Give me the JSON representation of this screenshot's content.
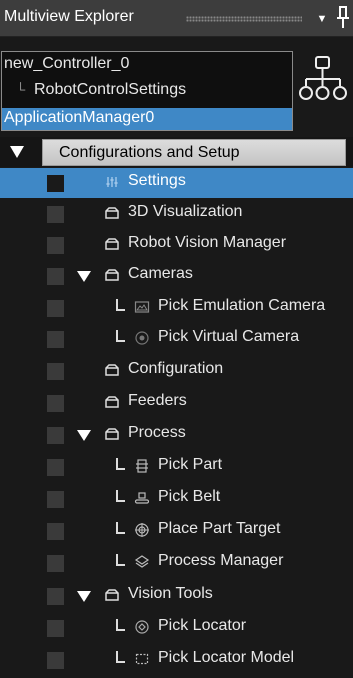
{
  "window": {
    "title": "Multiview Explorer"
  },
  "controller_box": {
    "controller": "new_Controller_0",
    "robot_settings": "RobotControlSettings",
    "app_manager": "ApplicationManager0"
  },
  "section": {
    "label": "Configurations and Setup"
  },
  "tree": [
    {
      "label": "Settings",
      "icon": "settings-icon"
    },
    {
      "label": "3D Visualization",
      "icon": "folder-icon"
    },
    {
      "label": "Robot Vision Manager",
      "icon": "folder-icon"
    },
    {
      "label": "Cameras",
      "icon": "folder-icon"
    },
    {
      "label": "Pick Emulation Camera",
      "icon": "emulation-camera-icon"
    },
    {
      "label": "Pick Virtual Camera",
      "icon": "virtual-camera-icon"
    },
    {
      "label": "Configuration",
      "icon": "folder-icon"
    },
    {
      "label": "Feeders",
      "icon": "folder-icon"
    },
    {
      "label": "Process",
      "icon": "folder-icon"
    },
    {
      "label": "Pick Part",
      "icon": "part-icon"
    },
    {
      "label": "Pick Belt",
      "icon": "belt-icon"
    },
    {
      "label": "Place Part Target",
      "icon": "part-target-icon"
    },
    {
      "label": "Process Manager",
      "icon": "process-manager-icon"
    },
    {
      "label": "Vision Tools",
      "icon": "folder-icon"
    },
    {
      "label": "Pick Locator",
      "icon": "locator-icon"
    },
    {
      "label": "Pick Locator Model",
      "icon": "locator-model-icon"
    }
  ],
  "colors": {
    "selection": "#3f88c6",
    "panel": "#191919",
    "titlebar": "#3d3d3d"
  }
}
